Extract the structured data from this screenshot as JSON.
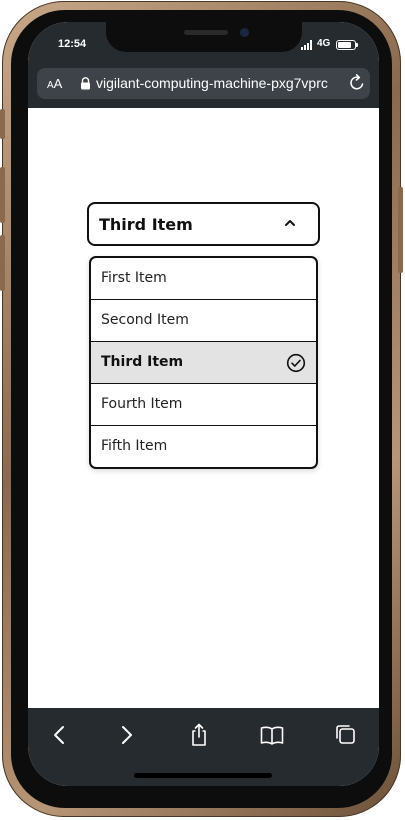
{
  "status_bar": {
    "time": "12:54",
    "network": "4G",
    "battery_level": 0.9
  },
  "browser": {
    "text_size_label_small": "A",
    "text_size_label_large": "A",
    "url": "vigilant-computing-machine-pxg7vprc",
    "icons": {
      "lock": "lock-icon",
      "reload": "reload-icon",
      "back": "back-icon",
      "forward": "forward-icon",
      "share": "share-icon",
      "bookmarks": "bookmarks-icon",
      "tabs": "tabs-icon"
    }
  },
  "select": {
    "value": "Third Item",
    "expanded": true,
    "options": [
      {
        "label": "First Item",
        "selected": false
      },
      {
        "label": "Second Item",
        "selected": false
      },
      {
        "label": "Third Item",
        "selected": true
      },
      {
        "label": "Fourth Item",
        "selected": false
      },
      {
        "label": "Fifth Item",
        "selected": false
      }
    ]
  },
  "colors": {
    "browser_chrome": "#262b30",
    "url_bar": "#3d4349",
    "selected_option_bg": "#e3e3e3",
    "border": "#111111"
  }
}
